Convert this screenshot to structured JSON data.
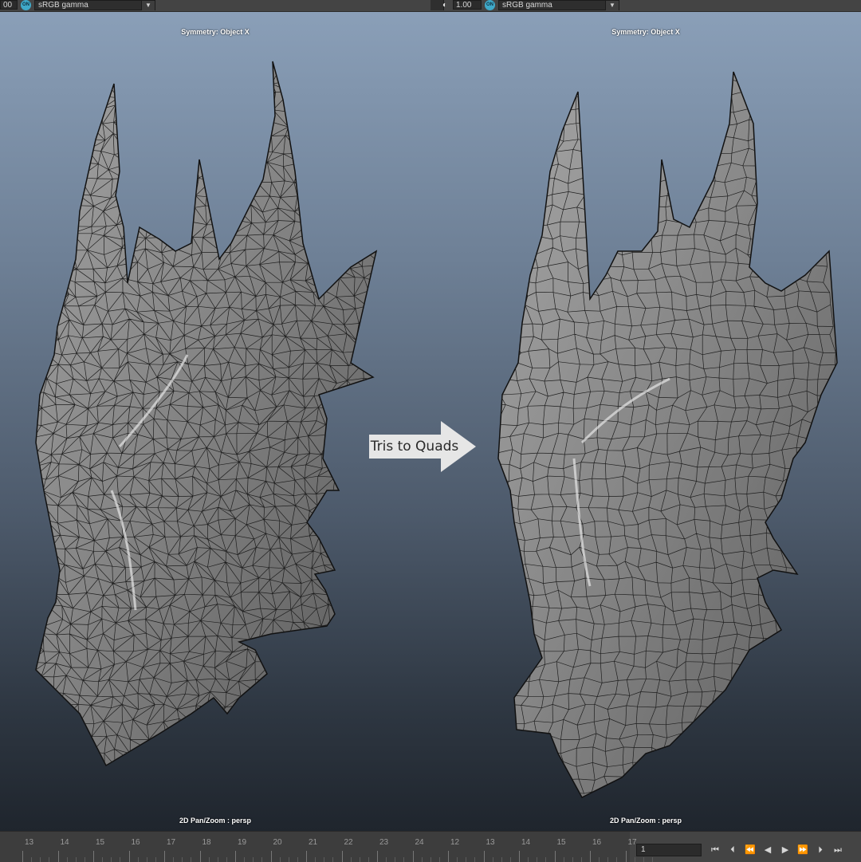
{
  "toolbar_left": {
    "exposure_value": "00",
    "colormanage_icon_label": "ON",
    "view_transform": "sRGB gamma",
    "icons": [
      "colormanage-icon",
      "dropdown-arrow-icon"
    ]
  },
  "toolbar_right": {
    "gamma_value": "1.00",
    "colormanage_icon_label": "ON",
    "view_transform": "sRGB gamma",
    "icons": [
      "exposure-icon",
      "colormanage-icon",
      "dropdown-arrow-icon"
    ]
  },
  "viewport_left": {
    "symmetry_label": "Symmetry: Object X",
    "camera_label": "2D Pan/Zoom : persp",
    "topology": "triangles"
  },
  "viewport_right": {
    "symmetry_label": "Symmetry: Object X",
    "camera_label": "2D Pan/Zoom : persp",
    "topology": "quads"
  },
  "annotation": {
    "arrow_label": "Tris to Quads",
    "arrow_color": "#e6e6e6"
  },
  "timeline": {
    "tick_labels": [
      "13",
      "14",
      "15",
      "16",
      "17",
      "18",
      "19",
      "20",
      "21",
      "22",
      "23",
      "24",
      "12",
      "13",
      "14",
      "15",
      "16",
      "17"
    ],
    "current_frame": "1",
    "transport_icons": [
      "go-to-start-icon",
      "step-back-icon",
      "step-back-key-icon",
      "play-backward-icon",
      "play-forward-icon",
      "step-forward-key-icon",
      "step-forward-icon",
      "go-to-end-icon"
    ]
  },
  "colors": {
    "viewport_top": "#8a9fb8",
    "viewport_bottom": "#1f252d",
    "ui_panel": "#444444",
    "mesh_fill": "#8c8c8c",
    "wire": "#1e1e1e"
  }
}
